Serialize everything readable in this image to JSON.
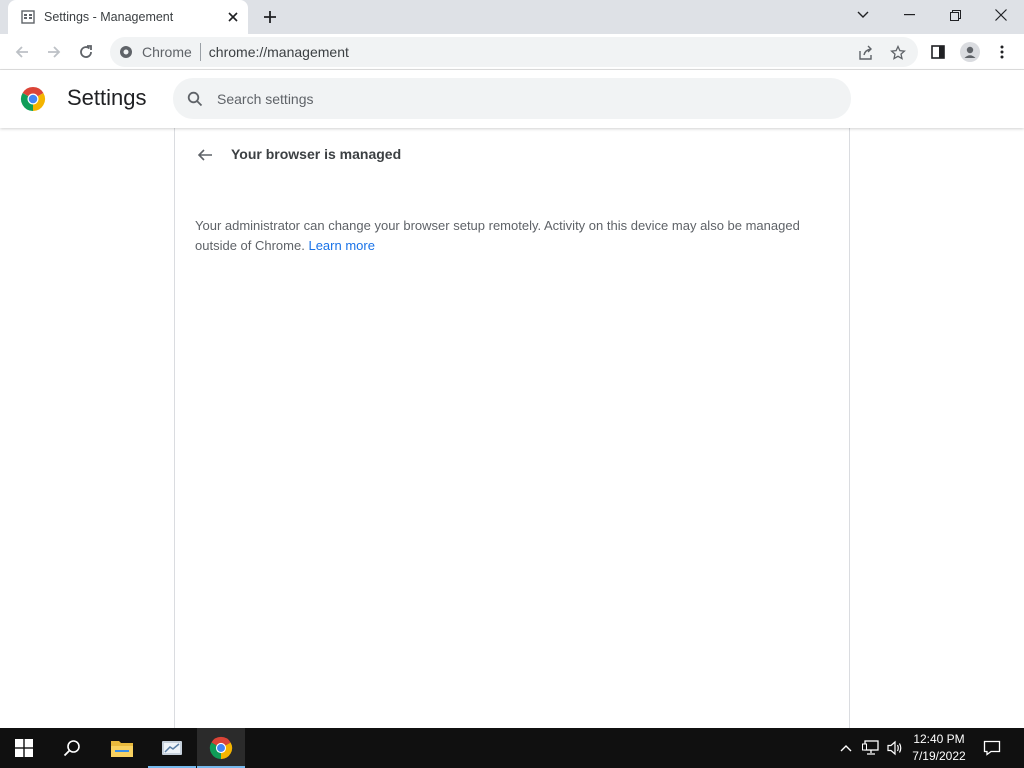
{
  "tab": {
    "title": "Settings - Management"
  },
  "omnibox": {
    "chip": "Chrome",
    "url": "chrome://management"
  },
  "settings": {
    "title": "Settings",
    "search_placeholder": "Search settings"
  },
  "page": {
    "heading": "Your browser is managed",
    "description": "Your administrator can change your browser setup remotely. Activity on this device may also be managed outside of Chrome.",
    "learn_more": "Learn more"
  },
  "taskbar": {
    "time": "12:40 PM",
    "date": "7/19/2022"
  },
  "colors": {
    "accent": "#1a73e8",
    "taskbar": "#101010",
    "tabstrip": "#dee1e6"
  }
}
